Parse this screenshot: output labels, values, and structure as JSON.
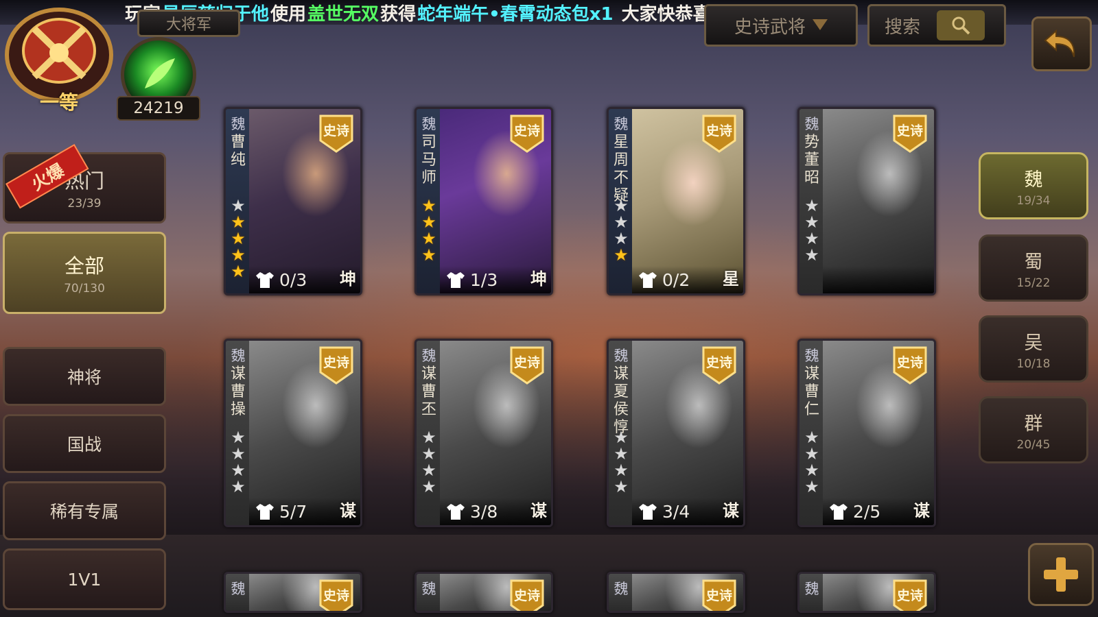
{
  "marquee": {
    "p1": "玩家",
    "player": "星辰慈归于他",
    "p2": "使用",
    "item": "盖世无双",
    "p3": "获得",
    "reward": "蛇年端午•春霄动态包x1",
    "p4": "大家快恭喜TA吧"
  },
  "header": {
    "tab_partial": "大将军",
    "filter_label": "史诗武将",
    "search_label": "搜索"
  },
  "player": {
    "rank": "一等",
    "score": "24219"
  },
  "left_menu": {
    "hot_badge": "火爆",
    "items": [
      {
        "label": "热门",
        "count": "23/39"
      },
      {
        "label": "全部",
        "count": "70/130"
      },
      {
        "label": "神将",
        "count": ""
      },
      {
        "label": "国战",
        "count": ""
      },
      {
        "label": "稀有专属",
        "count": ""
      },
      {
        "label": "1V1",
        "count": ""
      }
    ]
  },
  "right_menu": {
    "items": [
      {
        "label": "魏",
        "count": "19/34"
      },
      {
        "label": "蜀",
        "count": "15/22"
      },
      {
        "label": "吴",
        "count": "10/18"
      },
      {
        "label": "群",
        "count": "20/45"
      }
    ]
  },
  "cards": [
    {
      "kingdom": "魏",
      "name": "曹纯",
      "rarity": "史诗",
      "stars_on": 4,
      "stars_total": 5,
      "skins": "0/3",
      "type": "坤",
      "owned": true
    },
    {
      "kingdom": "魏",
      "name": "司马师",
      "rarity": "史诗",
      "stars_on": 4,
      "stars_total": 4,
      "skins": "1/3",
      "type": "坤",
      "owned": true
    },
    {
      "kingdom": "魏",
      "name": "星周不疑",
      "rarity": "史诗",
      "stars_on": 1,
      "stars_total": 4,
      "skins": "0/2",
      "type": "星",
      "owned": true
    },
    {
      "kingdom": "魏",
      "name": "势董昭",
      "rarity": "史诗",
      "stars_on": 0,
      "stars_total": 4,
      "skins": "",
      "type": "",
      "owned": false
    },
    {
      "kingdom": "魏",
      "name": "谋曹操",
      "rarity": "史诗",
      "stars_on": 0,
      "stars_total": 4,
      "skins": "5/7",
      "type": "谋",
      "owned": false
    },
    {
      "kingdom": "魏",
      "name": "谋曹丕",
      "rarity": "史诗",
      "stars_on": 0,
      "stars_total": 4,
      "skins": "3/8",
      "type": "谋",
      "owned": false
    },
    {
      "kingdom": "魏",
      "name": "谋夏侯惇",
      "rarity": "史诗",
      "stars_on": 0,
      "stars_total": 4,
      "skins": "3/4",
      "type": "谋",
      "owned": false
    },
    {
      "kingdom": "魏",
      "name": "谋曹仁",
      "rarity": "史诗",
      "stars_on": 0,
      "stars_total": 4,
      "skins": "2/5",
      "type": "谋",
      "owned": false
    },
    {
      "kingdom": "魏",
      "name": "",
      "rarity": "史诗",
      "stars_on": 0,
      "stars_total": 0,
      "skins": "",
      "type": "",
      "owned": false
    },
    {
      "kingdom": "魏",
      "name": "",
      "rarity": "史诗",
      "stars_on": 0,
      "stars_total": 0,
      "skins": "",
      "type": "",
      "owned": false
    },
    {
      "kingdom": "魏",
      "name": "",
      "rarity": "史诗",
      "stars_on": 0,
      "stars_total": 0,
      "skins": "",
      "type": "",
      "owned": false
    },
    {
      "kingdom": "魏",
      "name": "",
      "rarity": "史诗",
      "stars_on": 0,
      "stars_total": 0,
      "skins": "",
      "type": "",
      "owned": false
    }
  ],
  "icons": {
    "back": "back-arrow-icon",
    "add": "plus-icon",
    "search": "magnifier-icon",
    "filter": "dropdown-triangle-icon",
    "skin": "shirt-icon",
    "star": "star-icon"
  },
  "colors": {
    "marquee_highlight_cyan": "#53f2ff",
    "marquee_highlight_green": "#56ff63",
    "star_on": "#ffc21a",
    "active_gold": "#c9b06a"
  }
}
